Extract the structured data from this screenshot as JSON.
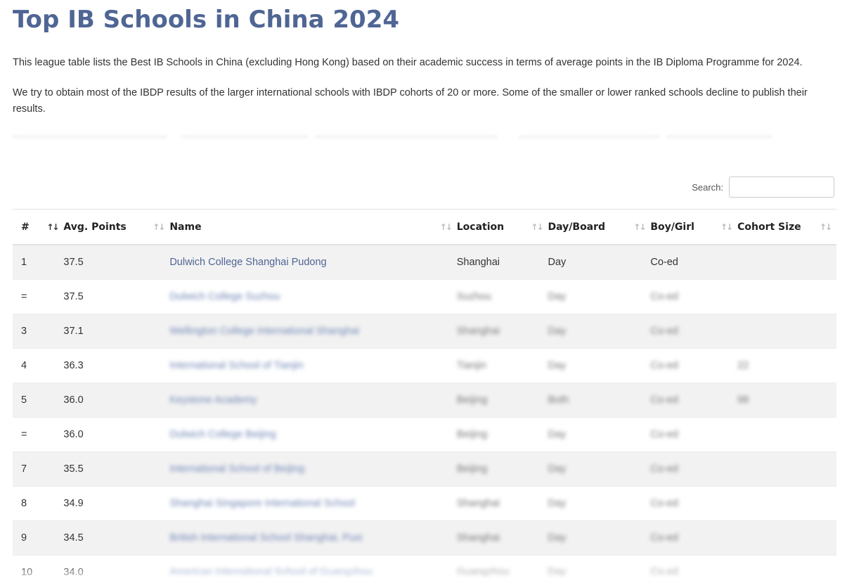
{
  "page": {
    "title": "Top IB Schools in China 2024",
    "intro": "This league table lists the Best IB Schools in China (excluding Hong Kong) based on their academic success in terms of average points in the IB Diploma Programme for 2024.",
    "note": "We try to obtain most of the IBDP results of the larger international schools with IBDP cohorts of 20 or more. Some of the smaller or lower ranked schools decline to publish their results."
  },
  "search": {
    "label": "Search:",
    "value": "",
    "placeholder": ""
  },
  "table": {
    "headers": {
      "rank": "#",
      "avg": "Avg. Points",
      "name": "Name",
      "location": "Location",
      "day_board": "Day/Board",
      "boy_girl": "Boy/Girl",
      "cohort": "Cohort Size"
    },
    "sort_icon": "sort-arrows-icon",
    "rows": [
      {
        "rank": "1",
        "avg": "37.5",
        "name": "Dulwich College Shanghai Pudong",
        "location": "Shanghai",
        "day_board": "Day",
        "boy_girl": "Co-ed",
        "cohort": ""
      },
      {
        "rank": "=",
        "avg": "37.5",
        "name": "Dulwich College Suzhou",
        "location": "Suzhou",
        "day_board": "Day",
        "boy_girl": "Co-ed",
        "cohort": ""
      },
      {
        "rank": "3",
        "avg": "37.1",
        "name": "Wellington College International Shanghai",
        "location": "Shanghai",
        "day_board": "Day",
        "boy_girl": "Co-ed",
        "cohort": ""
      },
      {
        "rank": "4",
        "avg": "36.3",
        "name": "International School of Tianjin",
        "location": "Tianjin",
        "day_board": "Day",
        "boy_girl": "Co-ed",
        "cohort": "22"
      },
      {
        "rank": "5",
        "avg": "36.0",
        "name": "Keystone Academy",
        "location": "Beijing",
        "day_board": "Both",
        "boy_girl": "Co-ed",
        "cohort": "98"
      },
      {
        "rank": "=",
        "avg": "36.0",
        "name": "Dulwich College Beijing",
        "location": "Beijing",
        "day_board": "Day",
        "boy_girl": "Co-ed",
        "cohort": ""
      },
      {
        "rank": "7",
        "avg": "35.5",
        "name": "International School of Beijing",
        "location": "Beijing",
        "day_board": "Day",
        "boy_girl": "Co-ed",
        "cohort": ""
      },
      {
        "rank": "8",
        "avg": "34.9",
        "name": "Shanghai Singapore International School",
        "location": "Shanghai",
        "day_board": "Day",
        "boy_girl": "Co-ed",
        "cohort": ""
      },
      {
        "rank": "9",
        "avg": "34.5",
        "name": "British International School Shanghai, Puxi",
        "location": "Shanghai",
        "day_board": "Day",
        "boy_girl": "Co-ed",
        "cohort": ""
      },
      {
        "rank": "10",
        "avg": "34.0",
        "name": "American International School of Guangzhou",
        "location": "Guangzhou",
        "day_board": "Day",
        "boy_girl": "Co-ed",
        "cohort": ""
      }
    ]
  },
  "colors": {
    "title": "#4f6594",
    "link": "#4f6594",
    "row_stripe": "#f2f2f2"
  }
}
